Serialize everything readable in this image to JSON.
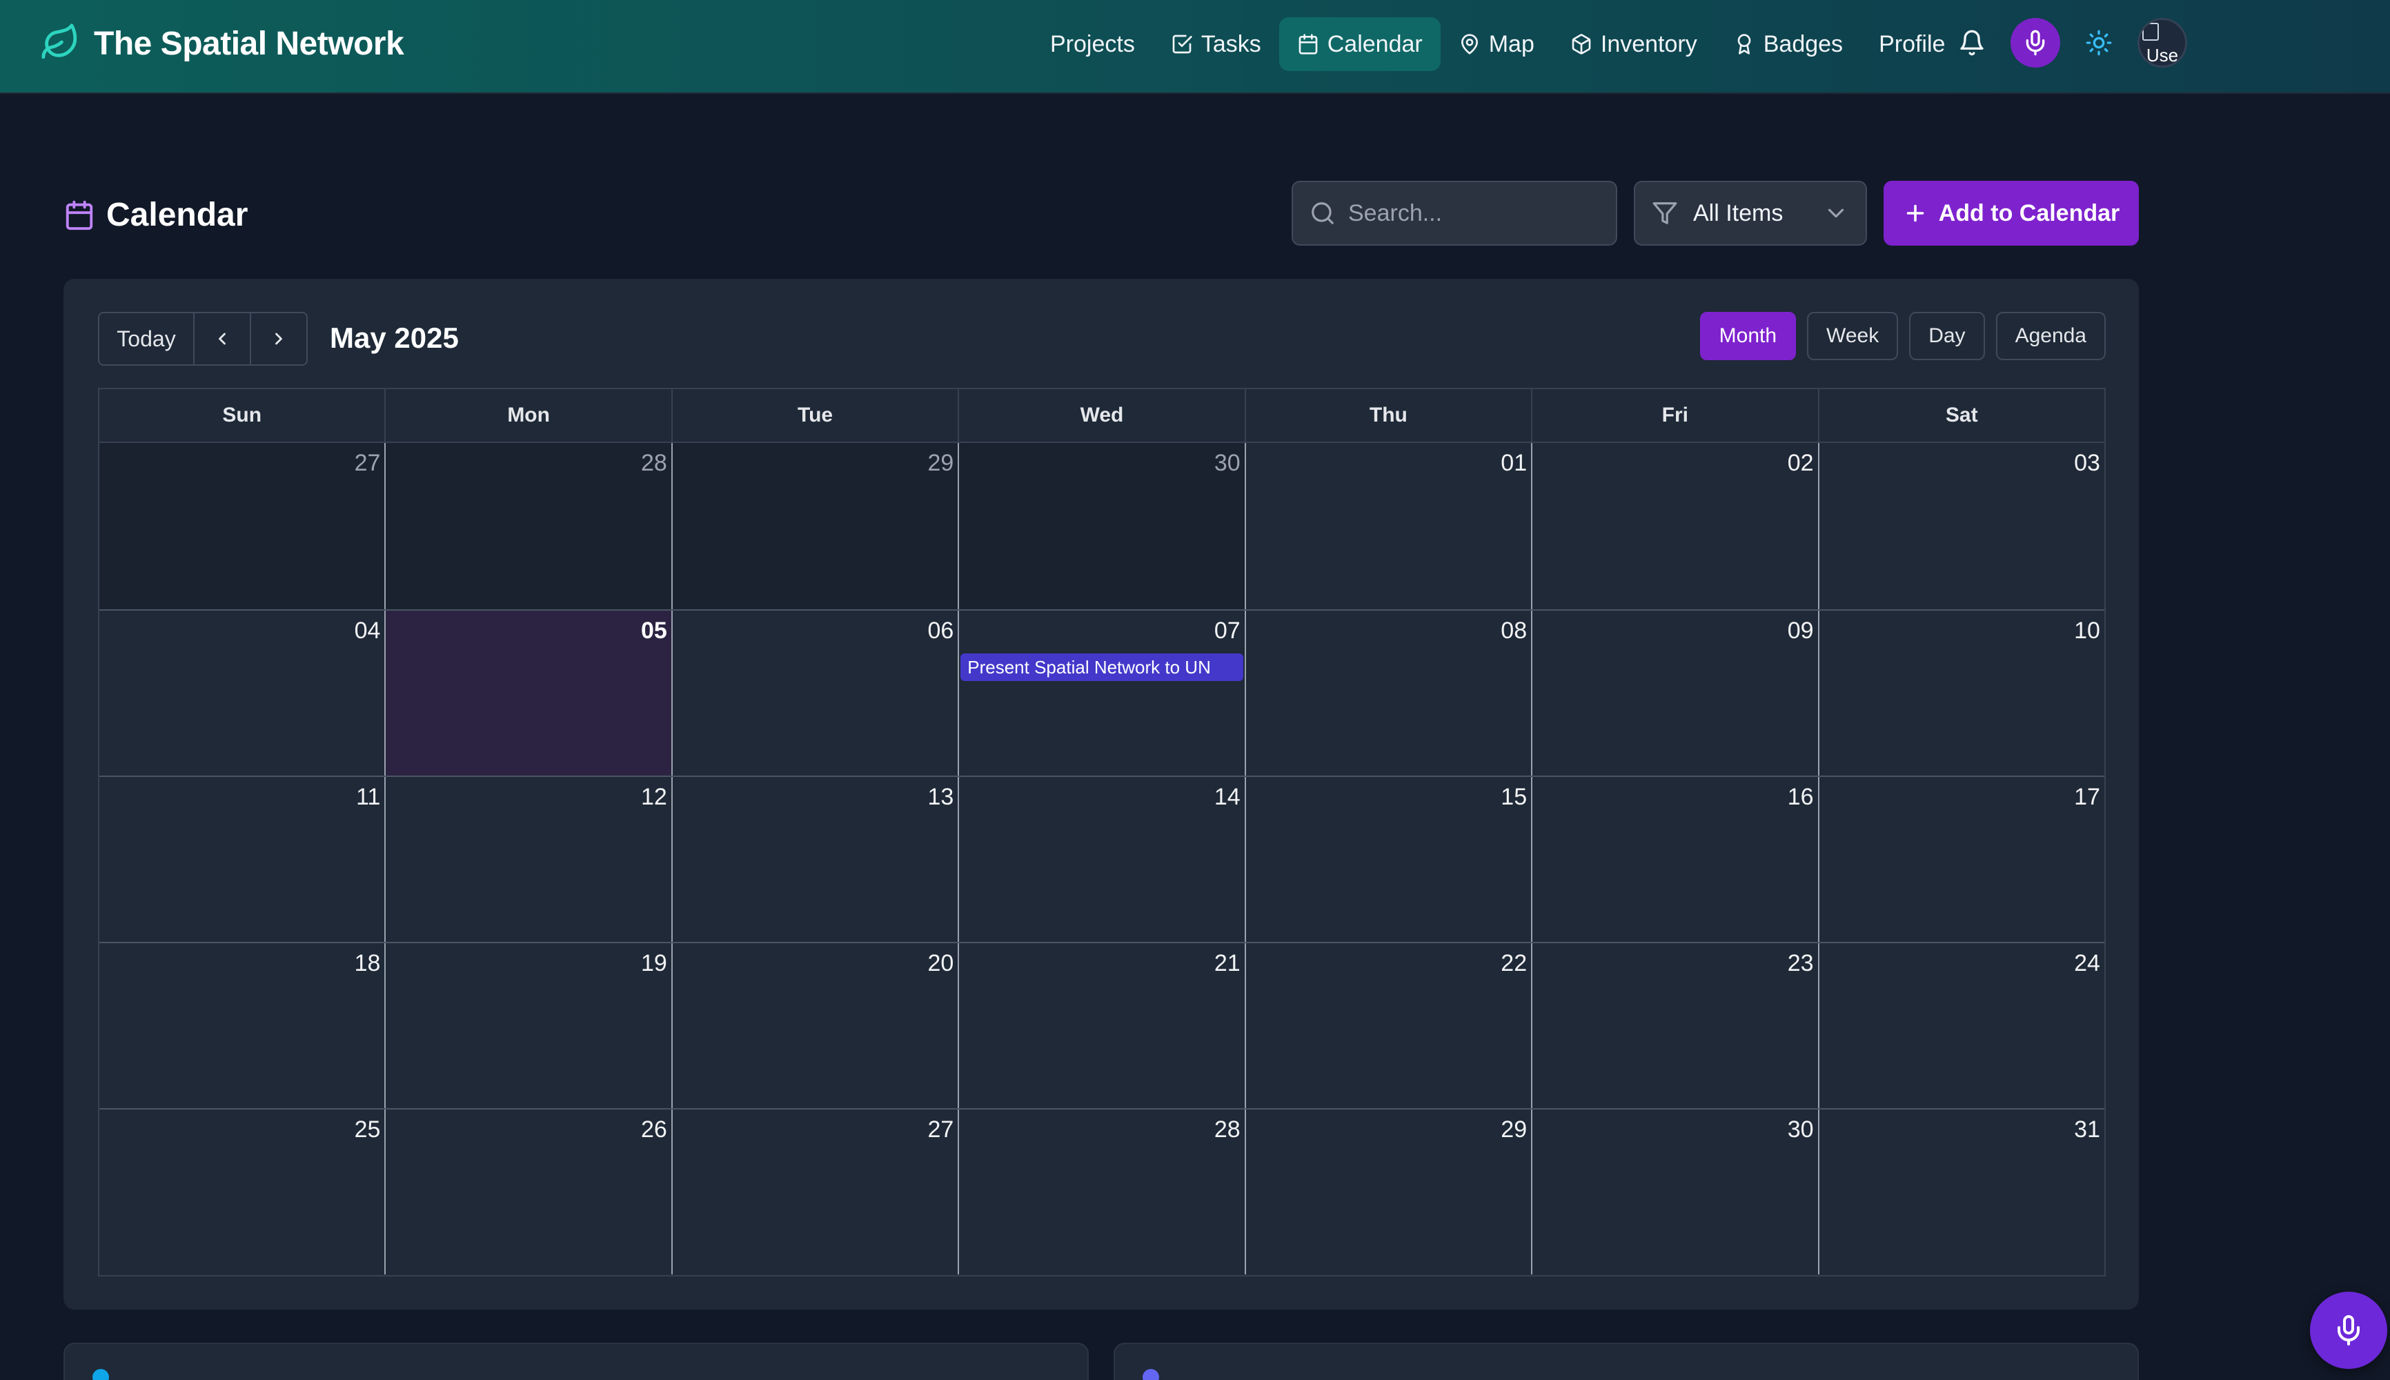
{
  "app": {
    "brand": "The Spatial Network"
  },
  "nav": {
    "items": [
      {
        "label": "Projects",
        "icon": "none"
      },
      {
        "label": "Tasks",
        "icon": "check-square-icon"
      },
      {
        "label": "Calendar",
        "icon": "calendar-icon",
        "active": true
      },
      {
        "label": "Map",
        "icon": "map-pin-icon"
      },
      {
        "label": "Inventory",
        "icon": "box-icon"
      },
      {
        "label": "Badges",
        "icon": "award-icon"
      },
      {
        "label": "Profile",
        "icon": "none"
      }
    ],
    "avatar_alt": "Use"
  },
  "page": {
    "title": "Calendar",
    "search_placeholder": "Search...",
    "filter_value": "All Items",
    "add_button": "Add to Calendar"
  },
  "calendar": {
    "today_label": "Today",
    "month_label": "May 2025",
    "views": [
      "Month",
      "Week",
      "Day",
      "Agenda"
    ],
    "active_view": "Month",
    "weekdays": [
      "Sun",
      "Mon",
      "Tue",
      "Wed",
      "Thu",
      "Fri",
      "Sat"
    ],
    "weeks": [
      [
        "27",
        "28",
        "29",
        "30",
        "01",
        "02",
        "03"
      ],
      [
        "04",
        "05",
        "06",
        "07",
        "08",
        "09",
        "10"
      ],
      [
        "11",
        "12",
        "13",
        "14",
        "15",
        "16",
        "17"
      ],
      [
        "18",
        "19",
        "20",
        "21",
        "22",
        "23",
        "24"
      ],
      [
        "25",
        "26",
        "27",
        "28",
        "29",
        "30",
        "31"
      ]
    ],
    "today": "05",
    "event": {
      "title": "Present Spatial Network to UN",
      "date": "07"
    }
  },
  "colors": {
    "accent": "#7e22ce",
    "navbar": "#0e4a52",
    "background": "#111827",
    "event": "#4338ca"
  }
}
